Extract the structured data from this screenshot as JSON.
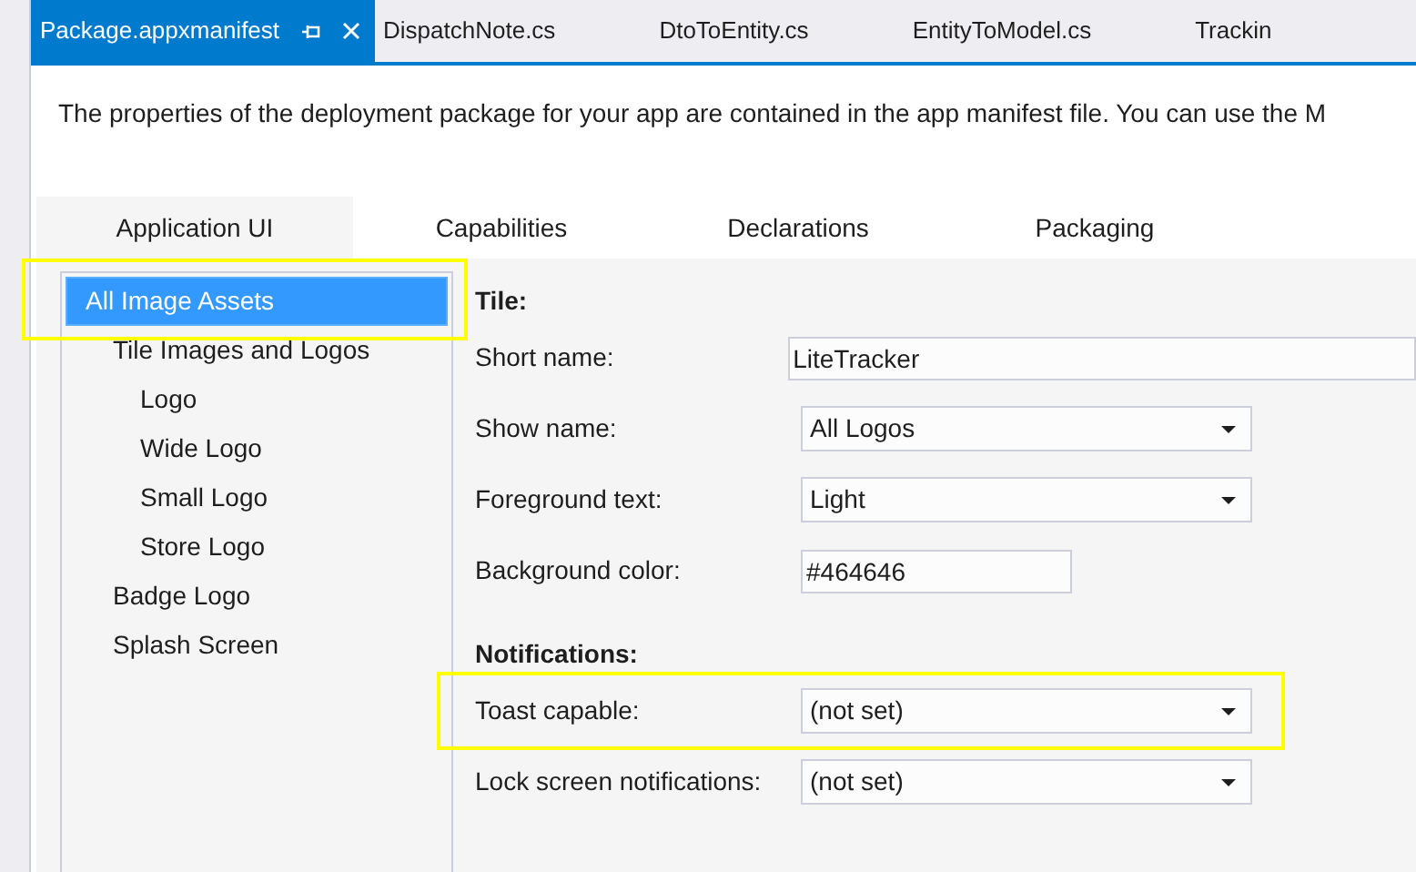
{
  "file_tabs": [
    {
      "label": "Package.appxmanifest",
      "selected": true,
      "pinnable": true
    },
    {
      "label": "DispatchNote.cs",
      "selected": false,
      "pinnable": false
    },
    {
      "label": "DtoToEntity.cs",
      "selected": false,
      "pinnable": false
    },
    {
      "label": "EntityToModel.cs",
      "selected": false,
      "pinnable": false
    },
    {
      "label": "Trackin",
      "selected": false,
      "pinnable": false
    }
  ],
  "description": "The properties of the deployment package for your app are contained in the app manifest file. You can use the M",
  "tabs": [
    {
      "label": "Application UI",
      "selected": true
    },
    {
      "label": "Capabilities",
      "selected": false
    },
    {
      "label": "Declarations",
      "selected": false
    },
    {
      "label": "Packaging",
      "selected": false
    }
  ],
  "tree": [
    {
      "label": "All Image Assets",
      "selected": true,
      "highlighted": true,
      "children": [
        {
          "label": "Tile Images and Logos",
          "selected": false,
          "highlighted": false,
          "children": [
            {
              "label": "Logo",
              "selected": false,
              "highlighted": false
            },
            {
              "label": "Wide Logo",
              "selected": false,
              "highlighted": false
            },
            {
              "label": "Small Logo",
              "selected": false,
              "highlighted": false
            },
            {
              "label": "Store Logo",
              "selected": false,
              "highlighted": false
            }
          ]
        },
        {
          "label": "Badge Logo",
          "selected": false,
          "highlighted": false
        },
        {
          "label": "Splash Screen",
          "selected": false,
          "highlighted": false
        }
      ]
    }
  ],
  "sections": [
    {
      "title": "Tile:",
      "fields": [
        {
          "kind": "text",
          "label": "Short name:",
          "value": "LiteTracker",
          "highlighted": false
        },
        {
          "kind": "dropdown",
          "label": "Show name:",
          "value": "All Logos",
          "highlighted": false
        },
        {
          "kind": "dropdown",
          "label": "Foreground text:",
          "value": "Light",
          "highlighted": false
        },
        {
          "kind": "color",
          "label": "Background color:",
          "value": "#464646",
          "highlighted": false
        }
      ]
    },
    {
      "title": "Notifications:",
      "fields": [
        {
          "kind": "dropdown",
          "label": "Toast capable:",
          "value": "(not set)",
          "highlighted": true
        },
        {
          "kind": "dropdown",
          "label": "Lock screen notifications:",
          "value": "(not set)",
          "highlighted": false
        }
      ]
    }
  ]
}
